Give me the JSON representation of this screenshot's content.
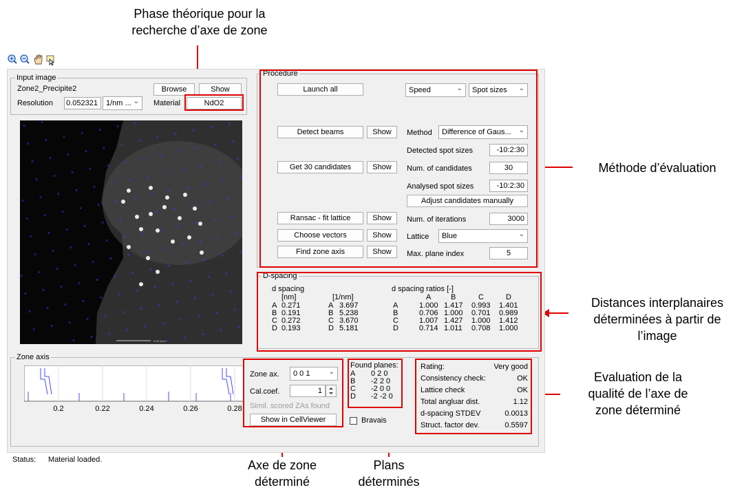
{
  "annotations": {
    "top": {
      "line1": "Phase théorique pour la",
      "line2": "recherche d’axe de zone"
    },
    "method": "Méthode d’évaluation",
    "distances": {
      "line1": "Distances interplanaires",
      "line2": "déterminées à partir de",
      "line3": "l’image"
    },
    "quality": {
      "line1": "Evaluation de la",
      "line2": "qualité de l’axe de",
      "line3": "zone déterminé"
    },
    "zone": {
      "line1": "Axe de zone",
      "line2": "déterminé"
    },
    "planes": {
      "line1": "Plans",
      "line2": "déterminés"
    }
  },
  "toolbar": {
    "icons": [
      "zoom-in-icon",
      "zoom-out-icon",
      "pan-hand-icon",
      "data-cursor-icon"
    ]
  },
  "input_image": {
    "title": "Input image",
    "filename": "Zone2_Precipite2",
    "browse_label": "Browse",
    "show_label": "Show",
    "resolution_label": "Resolution",
    "resolution_value": "0.052321",
    "resolution_unit": "1/nm ...",
    "material_label": "Material",
    "material_value": "NdO2",
    "scale_bar_text": "3.45 1/nm"
  },
  "procedure": {
    "title": "Procedure",
    "launch_all": "Launch all",
    "speed": "Speed",
    "spot_sizes_dd": "Spot sizes",
    "detect_beams": "Detect beams",
    "show": "Show",
    "method_label": "Method",
    "method_value": "Difference of Gaus...",
    "detected_spot_sizes_label": "Detected spot sizes",
    "detected_spot_sizes_value": "-10:2:30",
    "get_candidates": "Get 30 candidates",
    "num_candidates_label": "Num. of candidates",
    "num_candidates_value": "30",
    "analysed_spot_sizes_label": "Analysed spot sizes",
    "analysed_spot_sizes_value": "-10:2:30",
    "adjust_manually": "Adjust candidates manually",
    "ransac": "Ransac - fit lattice",
    "num_iterations_label": "Num. of iterations",
    "num_iterations_value": "3000",
    "choose_vectors": "Choose vectors",
    "lattice_label": "Lattice",
    "lattice_value": "Blue",
    "find_zone_axis": "Find zone axis",
    "max_plane_label": "Max. plane index",
    "max_plane_value": "5"
  },
  "dspacing": {
    "title": "D-spacing",
    "col1_header": "d spacing",
    "col1_unit": "[nm]",
    "col2_unit": "[1/nm]",
    "ratio_header": "d spacing ratios [-]",
    "ratio_cols": [
      "A",
      "B",
      "C",
      "D"
    ],
    "rows": [
      {
        "k": "A",
        "nm": "0.271",
        "inv": "3.697",
        "r": [
          "1.000",
          "1.417",
          "0.993",
          "1.401"
        ]
      },
      {
        "k": "B",
        "nm": "0.191",
        "inv": "5.238",
        "r": [
          "0.706",
          "1.000",
          "0.701",
          "0.989"
        ]
      },
      {
        "k": "C",
        "nm": "0.272",
        "inv": "3.670",
        "r": [
          "1.007",
          "1.427",
          "1.000",
          "1.412"
        ]
      },
      {
        "k": "D",
        "nm": "0.193",
        "inv": "5.181",
        "r": [
          "0.714",
          "1.011",
          "0.708",
          "1.000"
        ]
      }
    ]
  },
  "zone_axis": {
    "title": "Zone axis",
    "ticks": [
      "0.2",
      "0.22",
      "0.24",
      "0.26",
      "0.28"
    ],
    "zone_label": "Zone ax.",
    "zone_value": "0 0 1",
    "calcoef_label": "Cal.coef.",
    "calcoef_value": "1",
    "simil": "Simil. scored ZAs found",
    "show_cellviewer": "Show in CellViewer",
    "bravais": "Bravais"
  },
  "found_planes": {
    "title": "Found planes:",
    "rows": [
      {
        "k": "A",
        "v": "0 2 0"
      },
      {
        "k": "B",
        "v": "-2 2 0"
      },
      {
        "k": "C",
        "v": "-2 0 0"
      },
      {
        "k": "D",
        "v": "-2 -2 0"
      }
    ]
  },
  "rating": {
    "rows": [
      {
        "k": "Rating:",
        "v": "Very good"
      },
      {
        "k": "Consistency check:",
        "v": "OK"
      },
      {
        "k": "Lattice check",
        "v": "OK"
      },
      {
        "k": "Total angluar dist.",
        "v": "1.12"
      },
      {
        "k": "d-spacing STDEV",
        "v": "0.0013"
      },
      {
        "k": "Struct. factor dev.",
        "v": "0.5597"
      }
    ]
  },
  "status": {
    "label": "Status:",
    "value": "Material loaded."
  },
  "colors": {
    "accent_red": "#e00000",
    "lattice_blue": "#3b3bff"
  }
}
